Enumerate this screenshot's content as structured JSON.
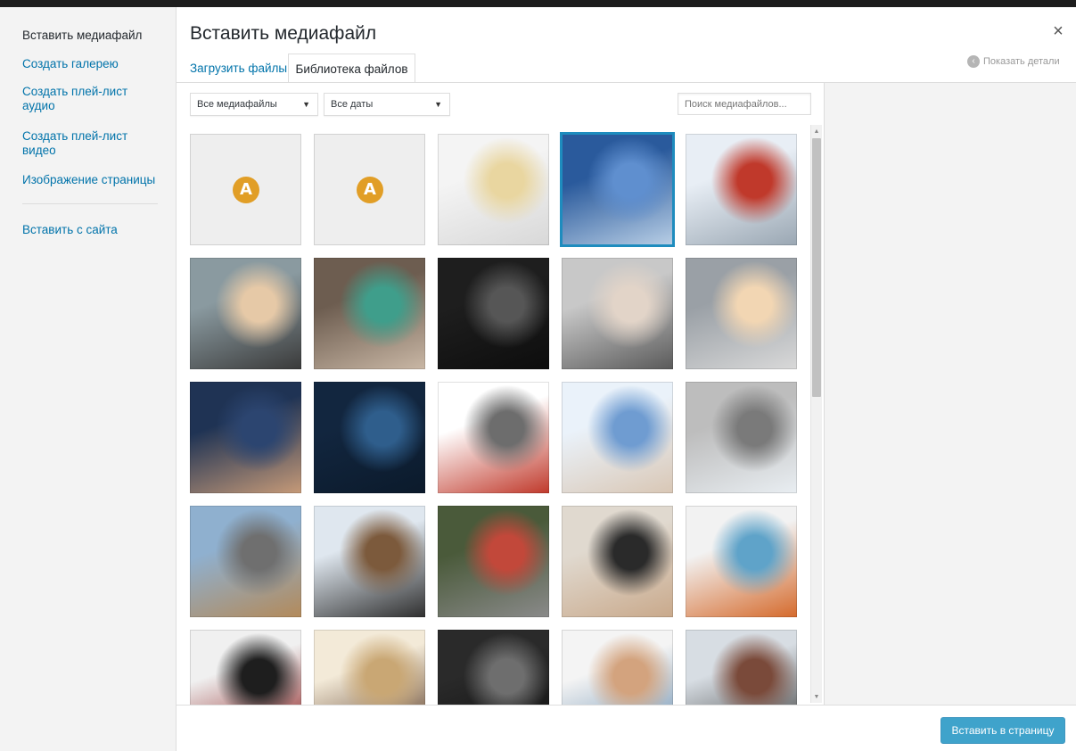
{
  "menu": {
    "items": [
      {
        "label": "Вставить медиафайл",
        "active": true
      },
      {
        "label": "Создать галерею"
      },
      {
        "label": "Создать плей-лист аудио"
      },
      {
        "label": "Создать плей-лист видео"
      },
      {
        "label": "Изображение страницы"
      },
      {
        "label": "Вставить с сайта"
      }
    ]
  },
  "header": {
    "title": "Вставить медиафайл",
    "close_glyph": "×",
    "tabs": [
      {
        "label": "Загрузить файлы"
      },
      {
        "label": "Библиотека файлов",
        "active": true
      }
    ],
    "details_label": "Показать детали",
    "details_icon": "chevron-left-circle-icon"
  },
  "toolbar": {
    "type_filter": "Все медиафайлы",
    "date_filter": "Все даты",
    "search_placeholder": "Поиск медиафайлов..."
  },
  "library": {
    "items": [
      {
        "kind": "document",
        "icon": "A",
        "icon_name": "document-a-icon",
        "colors": [
          "#eeeeee",
          "#eeeeee",
          "#eeeeee"
        ]
      },
      {
        "kind": "document",
        "icon": "A",
        "icon_name": "document-a-icon",
        "colors": [
          "#eeeeee",
          "#eeeeee",
          "#eeeeee"
        ]
      },
      {
        "kind": "image",
        "subject": "driving school car",
        "colors": [
          "#f4f4f4",
          "#e9d6a0",
          "#d8d8d8"
        ]
      },
      {
        "kind": "image",
        "subject": "man in blue car",
        "selected": true,
        "colors": [
          "#2a5a9c",
          "#5f8fcf",
          "#b9cfe6"
        ]
      },
      {
        "kind": "image",
        "subject": "group of cars",
        "colors": [
          "#e8eef5",
          "#c0392b",
          "#9aa7b3"
        ]
      },
      {
        "kind": "image",
        "subject": "woman portrait",
        "colors": [
          "#8a9aa0",
          "#e6c9a7",
          "#3a3a3a"
        ]
      },
      {
        "kind": "image",
        "subject": "exam passed screen",
        "colors": [
          "#6d5d50",
          "#3f9e8b",
          "#c9b7a5"
        ]
      },
      {
        "kind": "image",
        "subject": "gear shift",
        "colors": [
          "#1e1e1e",
          "#565656",
          "#0d0d0d"
        ]
      },
      {
        "kind": "image",
        "subject": "woman driving",
        "colors": [
          "#c8c8c8",
          "#e2d4c8",
          "#5a5a5a"
        ]
      },
      {
        "kind": "image",
        "subject": "smiling woman in car",
        "colors": [
          "#9aa0a6",
          "#f2d6b3",
          "#d9d9d9"
        ]
      },
      {
        "kind": "image",
        "subject": "car keys",
        "colors": [
          "#1f3354",
          "#2c4570",
          "#c69a78"
        ]
      },
      {
        "kind": "image",
        "subject": "dashboard",
        "colors": [
          "#12263f",
          "#2f5e8c",
          "#0b1a2b"
        ]
      },
      {
        "kind": "image",
        "subject": "traffic rules book",
        "colors": [
          "#ffffff",
          "#6d6d6d",
          "#c0392b"
        ]
      },
      {
        "kind": "image",
        "subject": "filling form",
        "colors": [
          "#eaf2fa",
          "#6f9cd1",
          "#d9c7b5"
        ]
      },
      {
        "kind": "image",
        "subject": "hammer and piggy bank",
        "colors": [
          "#bdbdbd",
          "#7a7a7a",
          "#e9eef2"
        ]
      },
      {
        "kind": "image",
        "subject": "first aid on road",
        "colors": [
          "#8fb0cf",
          "#6f6f6f",
          "#b38a5a"
        ]
      },
      {
        "kind": "image",
        "subject": "classroom",
        "colors": [
          "#dfe7ef",
          "#7c5a3c",
          "#2f2f2f"
        ]
      },
      {
        "kind": "image",
        "subject": "resuscitation",
        "colors": [
          "#4a5a3a",
          "#c2483a",
          "#8a8a8a"
        ]
      },
      {
        "kind": "image",
        "subject": "students at desks",
        "colors": [
          "#e0d9cf",
          "#2a2a2a",
          "#c9a98b"
        ]
      },
      {
        "kind": "image",
        "subject": "doctor writing",
        "colors": [
          "#f2f2f2",
          "#5fa3c9",
          "#d56a2c"
        ]
      },
      {
        "kind": "image",
        "subject": "camera and passport",
        "colors": [
          "#f0f0f0",
          "#1e1e1e",
          "#8a1c1c"
        ]
      },
      {
        "kind": "image",
        "subject": "books",
        "colors": [
          "#f3ead8",
          "#c9a774",
          "#5a3a24"
        ]
      },
      {
        "kind": "image",
        "subject": "gear knob",
        "colors": [
          "#2a2a2a",
          "#6e6e6e",
          "#111111"
        ]
      },
      {
        "kind": "image",
        "subject": "woman at computer",
        "colors": [
          "#f4f4f4",
          "#d3a37e",
          "#6b8fb0"
        ]
      },
      {
        "kind": "image",
        "subject": "exam room",
        "colors": [
          "#d7dde3",
          "#7a4a3a",
          "#3e3e3e"
        ]
      }
    ]
  },
  "footer": {
    "insert_label": "Вставить в страницу"
  }
}
